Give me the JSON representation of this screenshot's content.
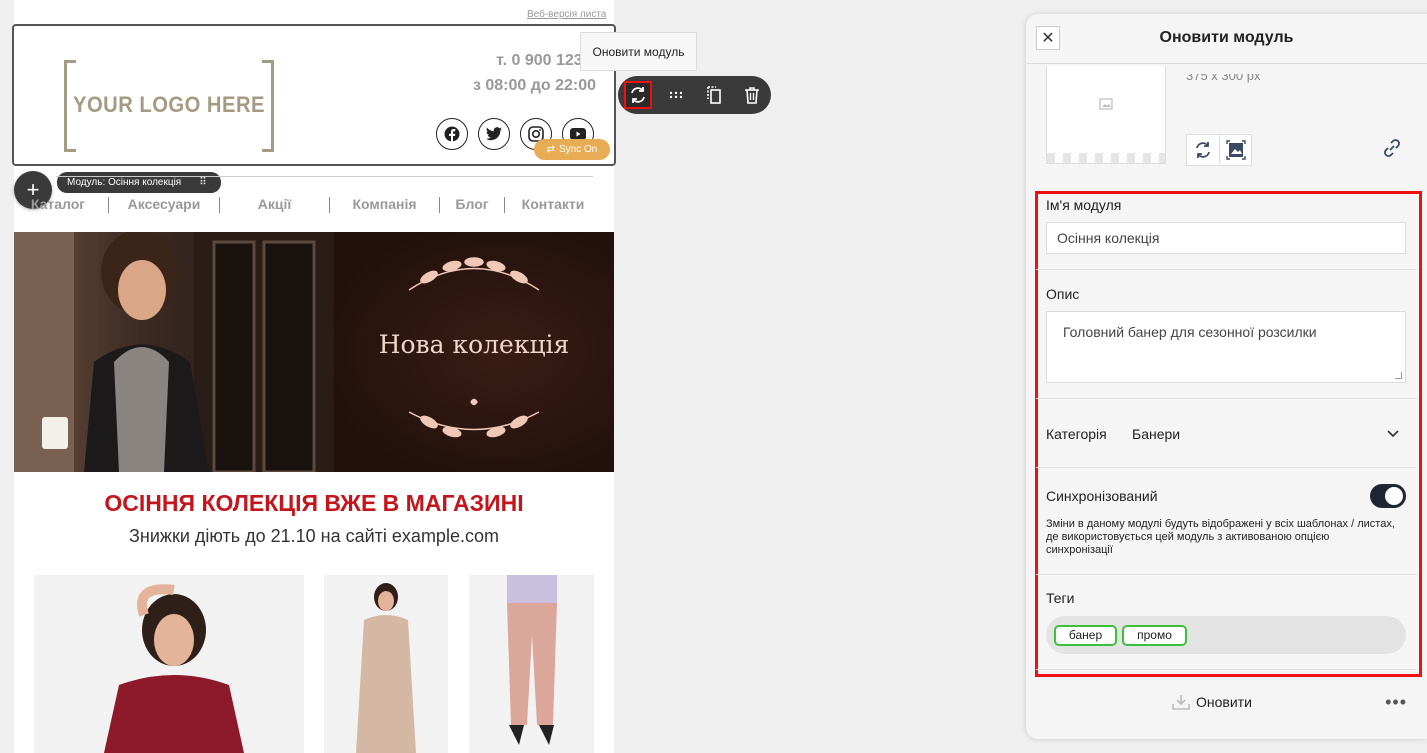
{
  "email": {
    "web_version": "Веб-версія листа",
    "logo_text": "YOUR LOGO HERE",
    "phone": "т. 0 900 123 4",
    "hours": "з 08:00 до 22:00",
    "socials": [
      "facebook-icon",
      "twitter-icon",
      "instagram-icon",
      "youtube-icon"
    ],
    "sync_badge": "Sync On",
    "module_label": "Модуль: Осіння колекція",
    "nav": [
      "Каталог",
      "Аксесуари",
      "Акції",
      "Компанія",
      "Блог",
      "Контакти"
    ],
    "banner_title": "Нова колекція",
    "headline": "ОСІННЯ КОЛЕКЦІЯ ВЖЕ В МАГАЗИНІ",
    "subline": "Знижки діють до 21.10 на сайті example.com"
  },
  "toolbar": {
    "tooltip": "Оновити модуль"
  },
  "panel": {
    "title": "Оновити модуль",
    "dimensions": "375 x 300 px",
    "name_label": "Ім'я модуля",
    "name_value": "Осіння колекція",
    "desc_label": "Опис",
    "desc_value": "Головний банер для сезонної розсилки",
    "category_label": "Категорія",
    "category_value": "Банери",
    "sync_label": "Синхронізований",
    "sync_on": true,
    "sync_desc": "Зміни в даному модулі будуть відображені у всіх шаблонах / листах, де використовується цей модуль з активованою опцією синхронізації",
    "tags_label": "Теги",
    "tags": [
      "банер",
      "промо"
    ],
    "update_button": "Оновити"
  },
  "colors": {
    "accent_red": "#e11111",
    "headline_red": "#c4151c",
    "sync_orange": "#e8ac55",
    "tag_green": "#3cc13c",
    "toggle_dark": "#1f2633"
  }
}
